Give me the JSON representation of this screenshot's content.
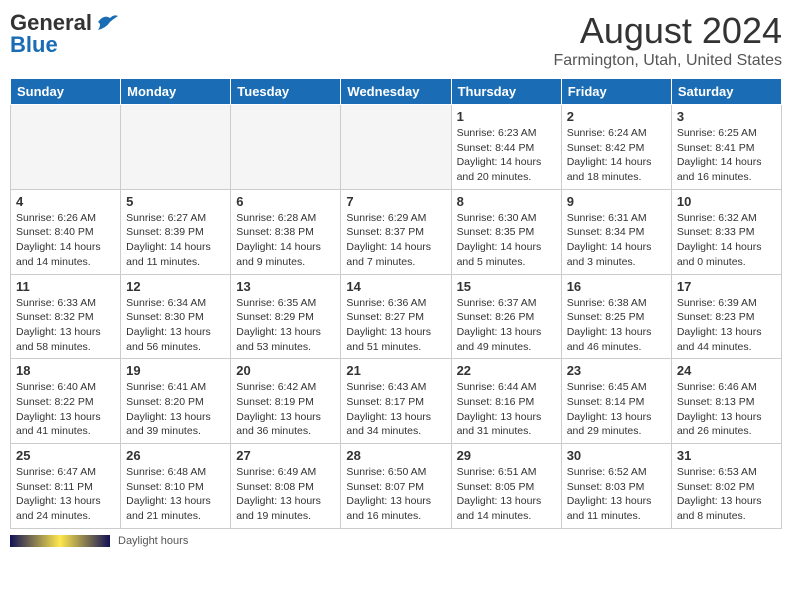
{
  "header": {
    "logo_line1": "General",
    "logo_line2": "Blue",
    "month_year": "August 2024",
    "location": "Farmington, Utah, United States"
  },
  "weekdays": [
    "Sunday",
    "Monday",
    "Tuesday",
    "Wednesday",
    "Thursday",
    "Friday",
    "Saturday"
  ],
  "weeks": [
    [
      {
        "day": "",
        "info": ""
      },
      {
        "day": "",
        "info": ""
      },
      {
        "day": "",
        "info": ""
      },
      {
        "day": "",
        "info": ""
      },
      {
        "day": "1",
        "info": "Sunrise: 6:23 AM\nSunset: 8:44 PM\nDaylight: 14 hours and 20 minutes."
      },
      {
        "day": "2",
        "info": "Sunrise: 6:24 AM\nSunset: 8:42 PM\nDaylight: 14 hours and 18 minutes."
      },
      {
        "day": "3",
        "info": "Sunrise: 6:25 AM\nSunset: 8:41 PM\nDaylight: 14 hours and 16 minutes."
      }
    ],
    [
      {
        "day": "4",
        "info": "Sunrise: 6:26 AM\nSunset: 8:40 PM\nDaylight: 14 hours and 14 minutes."
      },
      {
        "day": "5",
        "info": "Sunrise: 6:27 AM\nSunset: 8:39 PM\nDaylight: 14 hours and 11 minutes."
      },
      {
        "day": "6",
        "info": "Sunrise: 6:28 AM\nSunset: 8:38 PM\nDaylight: 14 hours and 9 minutes."
      },
      {
        "day": "7",
        "info": "Sunrise: 6:29 AM\nSunset: 8:37 PM\nDaylight: 14 hours and 7 minutes."
      },
      {
        "day": "8",
        "info": "Sunrise: 6:30 AM\nSunset: 8:35 PM\nDaylight: 14 hours and 5 minutes."
      },
      {
        "day": "9",
        "info": "Sunrise: 6:31 AM\nSunset: 8:34 PM\nDaylight: 14 hours and 3 minutes."
      },
      {
        "day": "10",
        "info": "Sunrise: 6:32 AM\nSunset: 8:33 PM\nDaylight: 14 hours and 0 minutes."
      }
    ],
    [
      {
        "day": "11",
        "info": "Sunrise: 6:33 AM\nSunset: 8:32 PM\nDaylight: 13 hours and 58 minutes."
      },
      {
        "day": "12",
        "info": "Sunrise: 6:34 AM\nSunset: 8:30 PM\nDaylight: 13 hours and 56 minutes."
      },
      {
        "day": "13",
        "info": "Sunrise: 6:35 AM\nSunset: 8:29 PM\nDaylight: 13 hours and 53 minutes."
      },
      {
        "day": "14",
        "info": "Sunrise: 6:36 AM\nSunset: 8:27 PM\nDaylight: 13 hours and 51 minutes."
      },
      {
        "day": "15",
        "info": "Sunrise: 6:37 AM\nSunset: 8:26 PM\nDaylight: 13 hours and 49 minutes."
      },
      {
        "day": "16",
        "info": "Sunrise: 6:38 AM\nSunset: 8:25 PM\nDaylight: 13 hours and 46 minutes."
      },
      {
        "day": "17",
        "info": "Sunrise: 6:39 AM\nSunset: 8:23 PM\nDaylight: 13 hours and 44 minutes."
      }
    ],
    [
      {
        "day": "18",
        "info": "Sunrise: 6:40 AM\nSunset: 8:22 PM\nDaylight: 13 hours and 41 minutes."
      },
      {
        "day": "19",
        "info": "Sunrise: 6:41 AM\nSunset: 8:20 PM\nDaylight: 13 hours and 39 minutes."
      },
      {
        "day": "20",
        "info": "Sunrise: 6:42 AM\nSunset: 8:19 PM\nDaylight: 13 hours and 36 minutes."
      },
      {
        "day": "21",
        "info": "Sunrise: 6:43 AM\nSunset: 8:17 PM\nDaylight: 13 hours and 34 minutes."
      },
      {
        "day": "22",
        "info": "Sunrise: 6:44 AM\nSunset: 8:16 PM\nDaylight: 13 hours and 31 minutes."
      },
      {
        "day": "23",
        "info": "Sunrise: 6:45 AM\nSunset: 8:14 PM\nDaylight: 13 hours and 29 minutes."
      },
      {
        "day": "24",
        "info": "Sunrise: 6:46 AM\nSunset: 8:13 PM\nDaylight: 13 hours and 26 minutes."
      }
    ],
    [
      {
        "day": "25",
        "info": "Sunrise: 6:47 AM\nSunset: 8:11 PM\nDaylight: 13 hours and 24 minutes."
      },
      {
        "day": "26",
        "info": "Sunrise: 6:48 AM\nSunset: 8:10 PM\nDaylight: 13 hours and 21 minutes."
      },
      {
        "day": "27",
        "info": "Sunrise: 6:49 AM\nSunset: 8:08 PM\nDaylight: 13 hours and 19 minutes."
      },
      {
        "day": "28",
        "info": "Sunrise: 6:50 AM\nSunset: 8:07 PM\nDaylight: 13 hours and 16 minutes."
      },
      {
        "day": "29",
        "info": "Sunrise: 6:51 AM\nSunset: 8:05 PM\nDaylight: 13 hours and 14 minutes."
      },
      {
        "day": "30",
        "info": "Sunrise: 6:52 AM\nSunset: 8:03 PM\nDaylight: 13 hours and 11 minutes."
      },
      {
        "day": "31",
        "info": "Sunrise: 6:53 AM\nSunset: 8:02 PM\nDaylight: 13 hours and 8 minutes."
      }
    ]
  ],
  "footer": {
    "legend_label": "Daylight hours"
  }
}
